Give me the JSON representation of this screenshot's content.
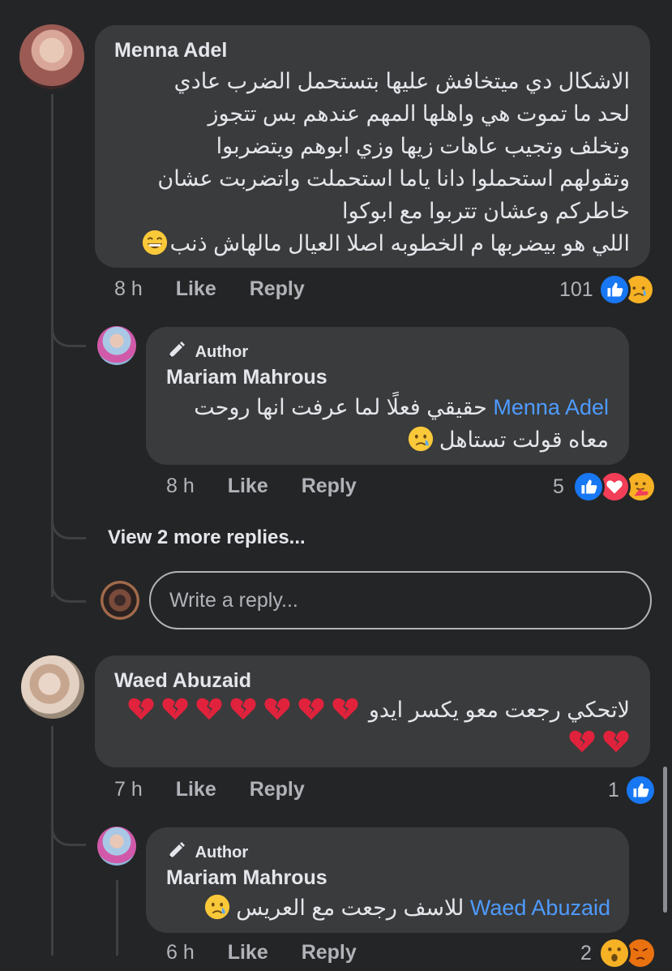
{
  "comments": [
    {
      "author": "Menna Adel",
      "lines": [
        "الاشكال دي ميتخافش عليها بتستحمل الضرب عادي",
        "لحد ما تموت هي واهلها المهم عندهم بس تتجوز",
        "وتخلف وتجيب عاهات زيها وزي ابوهم ويتضربوا",
        "وتقولهم استحملوا دانا ياما استحملت واتضربت عشان",
        "خاطركم وعشان تتربوا مع ابوكوا",
        "اللي هو بيضربها م الخطوبه اصلا العيال مالهاش ذنب"
      ],
      "emoji": "grinning-emoji",
      "time": "8 h",
      "like": "Like",
      "reply": "Reply",
      "reaction_count": "101",
      "reactions": [
        "like",
        "sad"
      ],
      "reply_item": {
        "badge": "Author",
        "author": "Mariam Mahrous",
        "mention": "Menna Adel",
        "line1": "حقيقي فعلًا لما عرفت انها روحت",
        "line2": "معاه قولت تستاهل",
        "emoji": "crying-face-emoji",
        "time": "8 h",
        "like": "Like",
        "reply": "Reply",
        "reaction_count": "5",
        "reactions": [
          "like",
          "love",
          "care"
        ]
      },
      "more_replies": "View 2 more replies...",
      "write_reply_placeholder": "Write a reply..."
    },
    {
      "author": "Waed Abuzaid",
      "text": "لاتحكي رجعت معو يكسر ايدو",
      "emoji": "broken-heart-emoji",
      "time": "7 h",
      "like": "Like",
      "reply": "Reply",
      "reaction_count": "1",
      "reactions": [
        "like"
      ],
      "reply_item": {
        "badge": "Author",
        "author": "Mariam Mahrous",
        "mention": "Waed Abuzaid",
        "text": "للاسف رجعت مع العريس",
        "emoji": "crying-face-emoji",
        "time": "6 h",
        "like": "Like",
        "reply": "Reply",
        "reaction_count": "2",
        "reactions": [
          "wow",
          "angry"
        ]
      }
    }
  ],
  "colors": {
    "background": "#242526",
    "bubble": "#3a3b3c",
    "text": "#e4e6eb",
    "secondary": "#b0b3b8",
    "mention": "#4e9bff",
    "like_blue": "#1877f2",
    "love_red": "#f33e58"
  }
}
